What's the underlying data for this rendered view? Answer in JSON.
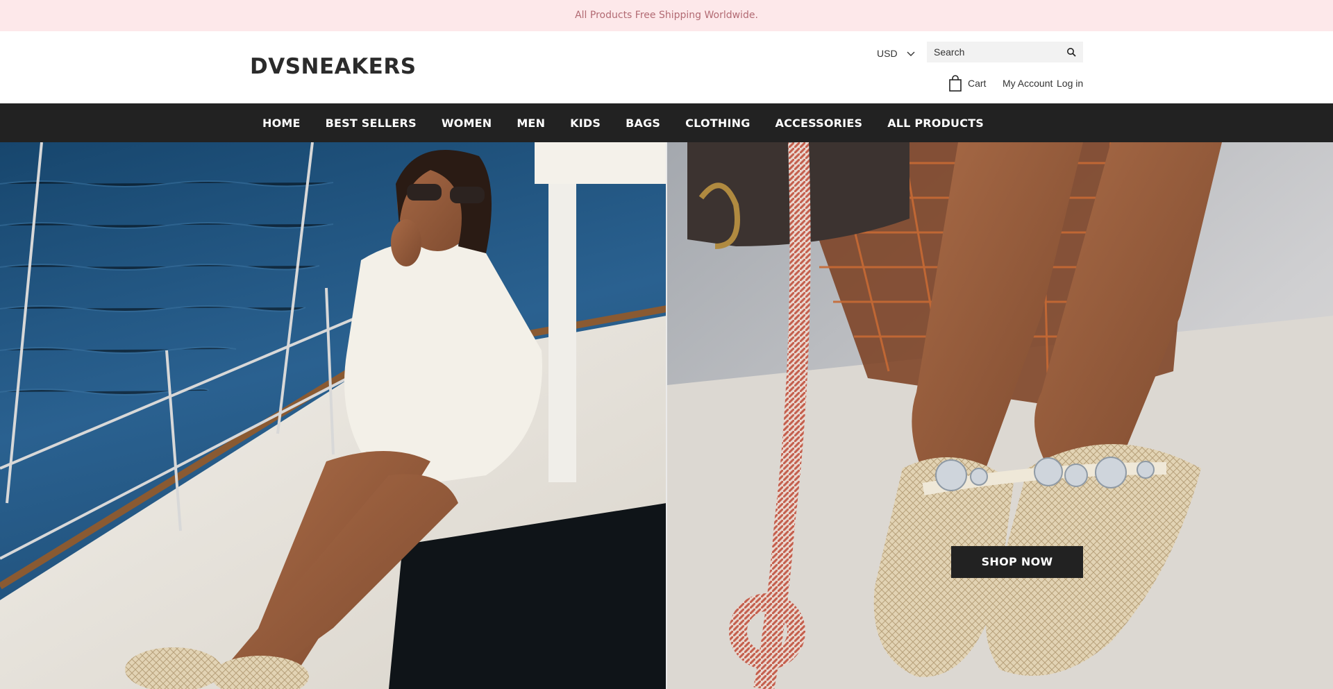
{
  "announcement": "All Products Free Shipping Worldwide.",
  "header": {
    "logo": "DVSNEAKERS",
    "currency": "USD",
    "search_placeholder": "Search",
    "cart_label": "Cart",
    "account_label": "My Account",
    "login_label": "Log in"
  },
  "nav": {
    "items": [
      "HOME",
      "BEST SELLERS",
      "WOMEN",
      "MEN",
      "KIDS",
      "BAGS",
      "CLOTHING",
      "ACCESSORIES",
      "ALL PRODUCTS"
    ]
  },
  "hero": {
    "cta_label": "SHOP NOW"
  },
  "colors": {
    "announcement_bg": "#fde8ea",
    "announcement_text": "#b26a73",
    "nav_bg": "#222222",
    "button_bg": "#222222"
  },
  "icons": [
    "chevron-down-icon",
    "search-icon",
    "shopping-bag-icon"
  ]
}
